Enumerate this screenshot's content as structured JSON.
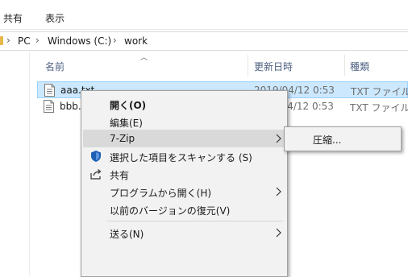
{
  "ribbon": {
    "tabs": [
      "共有",
      "表示"
    ]
  },
  "address_bar": {
    "breadcrumb": [
      "PC",
      "Windows (C:)",
      "work"
    ]
  },
  "file_list": {
    "columns": {
      "name": "名前",
      "modified": "更新日時",
      "type": "種類"
    },
    "rows": [
      {
        "name": "aaa.txt",
        "modified": "2019/04/12 0:53",
        "type": "TXT ファイル",
        "selected": true
      },
      {
        "name": "bbb.txt",
        "modified": "2019/04/12 0:53",
        "type": "TXT ファイル",
        "selected": false
      }
    ]
  },
  "context_menu": {
    "items": [
      {
        "label": "開く(O)",
        "bold": true
      },
      {
        "label": "編集(E)"
      },
      {
        "label": "7-Zip",
        "submenu": true,
        "hover": true
      },
      {
        "label": "選択した項目をスキャンする (S)",
        "icon": "defender-icon"
      },
      {
        "label": "共有",
        "icon": "share-icon"
      },
      {
        "label": "プログラムから開く(H)",
        "submenu": true
      },
      {
        "label": "以前のバージョンの復元(V)"
      },
      {
        "label": "送る(N)",
        "submenu": true
      }
    ]
  },
  "submenu_7zip": {
    "items": [
      {
        "label": "圧縮..."
      }
    ]
  },
  "colors": {
    "selection_fill": "#cce8ff",
    "selection_border": "#99d1ff",
    "menu_background": "#f2f2f2",
    "menu_hover": "#d9d9d9",
    "header_text": "#4d6082",
    "folder_yellow": "#e7b948",
    "defender_blue": "#1e5fb4"
  }
}
